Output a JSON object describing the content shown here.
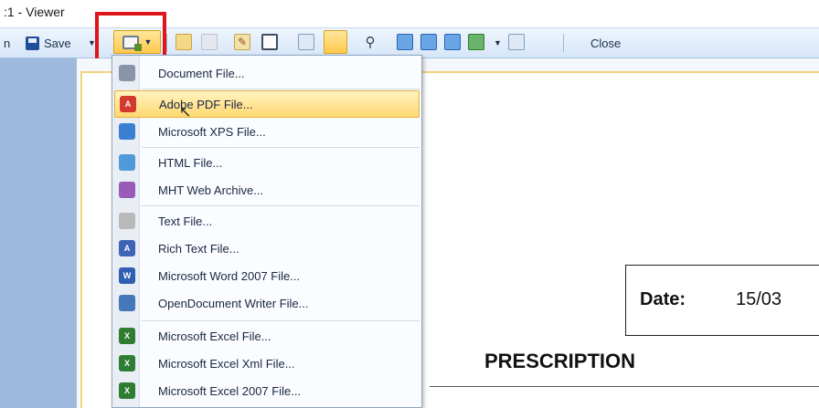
{
  "window": {
    "title": ":1 - Viewer"
  },
  "toolbar": {
    "partial_label": "n",
    "save_label": "Save",
    "close_label": "Close",
    "icons": [
      "export-icon",
      "page-icon",
      "page-gray-icon",
      "edit-icon",
      "single-page-icon",
      "page-view-icon",
      "page-view-active-icon",
      "find-icon",
      "view-blue-1-icon",
      "view-blue-2-icon",
      "view-blue-3-icon",
      "view-green-icon",
      "view-extra-icon"
    ]
  },
  "export_menu": {
    "items": [
      {
        "label": "Document File...",
        "icon": "document-file-icon",
        "color": "#8a94a8"
      },
      {
        "label": "Adobe PDF File...",
        "icon": "pdf-file-icon",
        "color": "#d43a2e",
        "selected": true
      },
      {
        "label": "Microsoft XPS File...",
        "icon": "xps-file-icon",
        "color": "#3a7fd0"
      },
      {
        "label": "HTML File...",
        "icon": "html-file-icon",
        "color": "#4f9ad8"
      },
      {
        "label": "MHT Web Archive...",
        "icon": "mht-file-icon",
        "color": "#9a5ab8"
      },
      {
        "label": "Text File...",
        "icon": "text-file-icon",
        "color": "#b9b9b9"
      },
      {
        "label": "Rich Text File...",
        "icon": "rich-text-file-icon",
        "color": "#3f64b5"
      },
      {
        "label": "Microsoft Word 2007 File...",
        "icon": "word-file-icon",
        "color": "#2f5fb0"
      },
      {
        "label": "OpenDocument Writer File...",
        "icon": "odt-file-icon",
        "color": "#4677b8"
      },
      {
        "label": "Microsoft Excel File...",
        "icon": "excel-file-icon",
        "color": "#2e7d32"
      },
      {
        "label": "Microsoft Excel Xml File...",
        "icon": "excel-xml-file-icon",
        "color": "#2e7d32"
      },
      {
        "label": "Microsoft Excel 2007 File...",
        "icon": "excel-2007-file-icon",
        "color": "#2e7d32"
      }
    ]
  },
  "document": {
    "date_label": "Date:",
    "date_value": "15/03",
    "heading": "PRESCRIPTION"
  },
  "colors": {
    "highlight": "#e0141b",
    "menu_selected": "#ffd870"
  }
}
